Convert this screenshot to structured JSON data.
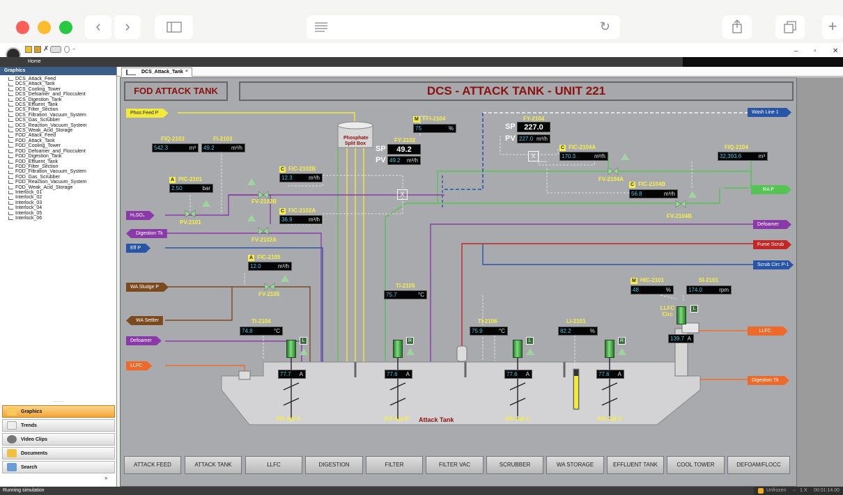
{
  "safari": {
    "reload_icon": "reload-icon"
  },
  "ribbon": {
    "home_label": "Home",
    "win_min": "–",
    "win_max": "▫",
    "win_close": "✕"
  },
  "sidebar": {
    "header": "Graphics",
    "items": [
      "DCS_Attack_Feed",
      "DCS_Attack_Tank",
      "DCS_Cooling_Tower",
      "DCS_Defoamer_and_Flocculent",
      "DCS_Digestion_Tank",
      "DCS_Effluent_Tank",
      "DCS_Filter_Section",
      "DCS_Filtration_Vacuum_System",
      "DCS_Gas_Scrubber",
      "DCS_Reaction_Vacuum_System",
      "DCS_Weak_Acid_Storage",
      "FOD_Attack_Feed",
      "FOD_Attack_Tank",
      "FOD_Cooling_Tower",
      "FOD_Defoamer_and_Flocculent",
      "FOD_Digestion_Tank",
      "FOD_Effluent_Tank",
      "FOD_Filter_Section",
      "FOD_Filtration_Vacuum_System",
      "FOD_Gas_Scrubber",
      "FOD_Reaction_Vacuum_System",
      "FOD_Weak_Acid_Storage",
      "Interlock_01",
      "Interlock_02",
      "Interlock_03",
      "Interlock_04",
      "Interlock_05",
      "Interlock_06"
    ],
    "nav": [
      "Graphics",
      "Trends",
      "Video Clips",
      "Documents",
      "Search"
    ],
    "expand": "»"
  },
  "tab": {
    "label": "DCS_Attack_Tank",
    "close": "×"
  },
  "screen": {
    "title_left": "FOD ATTACK TANK",
    "title_main": "DCS - ATTACK TANK - UNIT 221",
    "split_box": "Phosphate Split Box",
    "tank_label": "Attack Tank",
    "streams": {
      "phos_feed": "Phos Feed P",
      "h2so4": "H₂SO₄",
      "digestion_in": "Digestion Tk",
      "eff_p": "Eff P",
      "wa_sludge": "WA Sludge P",
      "wa_settler": "WA Settler",
      "defoamer_in": "Defoamer",
      "llfc_in": "LLFC",
      "wash_line": "Wash Line 1",
      "ra_p": "RA P",
      "defoamer_out": "Defoamer",
      "fume_scrub": "Fume Scrub",
      "scrub_circ": "Scrub Circ P-1",
      "llfc_out": "LLFC",
      "digestion_out": "Digestion Tk"
    },
    "tags": {
      "fiq2103": {
        "name": "FIQ-2103",
        "value": "542.3",
        "unit": "m³"
      },
      "fi2103": {
        "name": "FI-2103",
        "value": "49.2",
        "unit": "m³/h"
      },
      "pic2101": {
        "name": "PIC-2101",
        "mode": "A",
        "value": "2.50",
        "unit": "bar"
      },
      "fic2102b": {
        "name": "FIC-2102B",
        "mode": "C",
        "value": "12.3",
        "unit": "m³/h"
      },
      "fic2102a": {
        "name": "FIC-2102A",
        "mode": "C",
        "value": "36.9",
        "unit": "m³/h"
      },
      "fy2102": {
        "name": "FY-2102",
        "sp": "49.2",
        "pv": "49.2",
        "unit": "m³/h"
      },
      "ffi2104": {
        "name": "FFI-2104",
        "mode": "M",
        "value": "75",
        "unit": "%"
      },
      "fy2104": {
        "name": "FY-2104",
        "sp": "227.0",
        "pv": "227.0",
        "unit": "m³/h"
      },
      "fic2104a": {
        "name": "FIC-2104A",
        "mode": "C",
        "value": "170.3",
        "unit": "m³/h"
      },
      "fic2104b": {
        "name": "FIC-2104B",
        "mode": "C",
        "value": "56.8",
        "unit": "m³/h"
      },
      "fiq2104": {
        "name": "FIQ-2104",
        "value": "32,393.6",
        "unit": "m³"
      },
      "fic2105": {
        "name": "FIC-2105",
        "mode": "A",
        "value": "12.0",
        "unit": "m³/h"
      },
      "ti2105": {
        "name": "TI-2105",
        "value": "75.7",
        "unit": "°C"
      },
      "ti2104": {
        "name": "TI-2104",
        "value": "74.8",
        "unit": "°C"
      },
      "ti2106": {
        "name": "TI-2106",
        "value": "75.9",
        "unit": "°C"
      },
      "li2101": {
        "name": "LI-2101",
        "value": "82.2",
        "unit": "%"
      },
      "hic2101": {
        "name": "HIC-2101",
        "mode": "M",
        "value": "48",
        "unit": "%"
      },
      "si2101": {
        "name": "SI-2101",
        "value": "174.0",
        "unit": "rpm"
      }
    },
    "sp_label": "SP",
    "pv_label": "PV",
    "valves": {
      "pv2101": "PV-2101",
      "fv2102b": "FV-2102B",
      "fv2102a": "FV-2102A",
      "fv2104a": "FV-2104A",
      "fv2104b": "FV-2104B",
      "fv2105": "FV-2105"
    },
    "agitators": [
      {
        "label": "Atk Agi A",
        "amps": "77.7",
        "unit": "A",
        "mode": "L"
      },
      {
        "label": "Atk Agi B",
        "amps": "77.6",
        "unit": "A",
        "mode": "R"
      },
      {
        "label": "Atk Agi C",
        "amps": "77.6",
        "unit": "A",
        "mode": "L"
      },
      {
        "label": "Atk Agi D",
        "amps": "77.6",
        "unit": "A",
        "mode": "R"
      }
    ],
    "llfc_pump": {
      "label": "LLFC Circ",
      "amps": "139.7",
      "unit": "A",
      "mode": "L"
    },
    "x_marker": "X",
    "bottom_nav": [
      "ATTACK FEED",
      "ATTACK TANK",
      "LLFC",
      "DIGESTION",
      "FILTER",
      "FILTER VAC",
      "SCRUBBER",
      "WA STORAGE",
      "EFFLUENT TANK",
      "COOL TOWER",
      "DEFOAM/FLOCC"
    ]
  },
  "status": {
    "left": "Running simulation",
    "right": "Unfrozen",
    "speed": "1 X",
    "clock": "00:01:14.00",
    "dash": "–"
  },
  "colors": {
    "phos": "#f2e93b",
    "green": "#55c455",
    "purple": "#8a3aa8",
    "blue": "#2955a8",
    "brown": "#7a4a1e",
    "orange": "#ee6a2a",
    "red": "#c42626",
    "title": "#8b1010"
  }
}
